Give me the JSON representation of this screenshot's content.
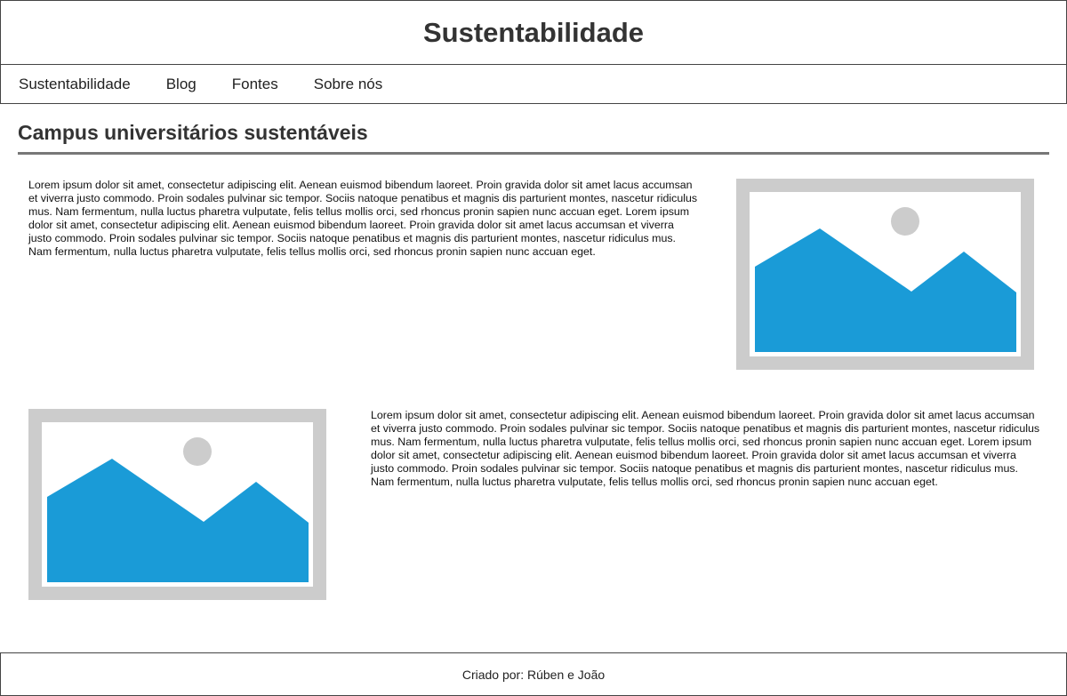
{
  "header": {
    "title": "Sustentabilidade"
  },
  "nav": {
    "items": [
      {
        "label": "Sustentabilidade"
      },
      {
        "label": "Blog"
      },
      {
        "label": "Fontes"
      },
      {
        "label": "Sobre nós"
      }
    ]
  },
  "main": {
    "title": "Campus universitários sustentáveis",
    "sections": [
      {
        "text": "Lorem ipsum dolor sit amet, consectetur adipiscing elit. Aenean euismod bibendum laoreet. Proin gravida dolor sit amet lacus accumsan et viverra justo commodo. Proin sodales pulvinar sic tempor. Sociis natoque penatibus et magnis dis parturient montes, nascetur ridiculus mus. Nam fermentum, nulla luctus pharetra vulputate, felis tellus mollis orci, sed rhoncus pronin sapien nunc accuan eget. Lorem ipsum dolor sit amet, consectetur adipiscing elit. Aenean euismod bibendum laoreet. Proin gravida dolor sit amet lacus accumsan et viverra justo commodo. Proin sodales pulvinar sic tempor. Sociis natoque penatibus et magnis dis parturient montes, nascetur ridiculus mus. Nam fermentum, nulla luctus pharetra vulputate, felis tellus mollis orci, sed rhoncus pronin sapien nunc accuan eget.",
        "image_icon": "image-placeholder-icon"
      },
      {
        "text": "Lorem ipsum dolor sit amet, consectetur adipiscing elit. Aenean euismod bibendum laoreet. Proin gravida dolor sit amet lacus accumsan et viverra justo commodo. Proin sodales pulvinar sic tempor. Sociis natoque penatibus et magnis dis parturient montes, nascetur ridiculus mus. Nam fermentum, nulla luctus pharetra vulputate, felis tellus mollis orci, sed rhoncus pronin sapien nunc accuan eget. Lorem ipsum dolor sit amet, consectetur adipiscing elit. Aenean euismod bibendum laoreet. Proin gravida dolor sit amet lacus accumsan et viverra justo commodo. Proin sodales pulvinar sic tempor. Sociis natoque penatibus et magnis dis parturient montes, nascetur ridiculus mus. Nam fermentum, nulla luctus pharetra vulputate, felis tellus mollis orci, sed rhoncus pronin sapien nunc accuan eget.",
        "image_icon": "image-placeholder-icon"
      }
    ]
  },
  "footer": {
    "credit": "Criado por: Rúben e João"
  },
  "colors": {
    "border": "#444444",
    "title_rule": "#777777",
    "placeholder_frame": "#cccccc",
    "placeholder_mountain": "#1a9bd7",
    "placeholder_sun": "#cccccc"
  }
}
